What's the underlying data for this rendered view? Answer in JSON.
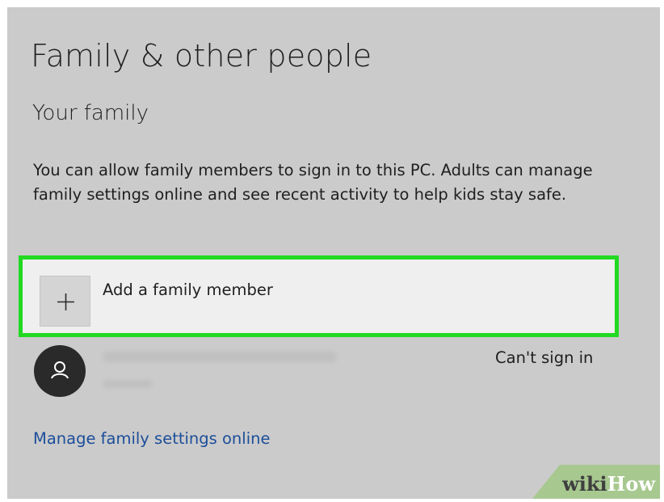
{
  "header": {
    "title": "Family & other people"
  },
  "family": {
    "section_title": "Your family",
    "description": "You can allow family members to sign in to this PC. Adults can manage family settings online and see recent activity to help kids stay safe.",
    "add_member_label": "Add a family member",
    "add_icon": "plus-icon",
    "member": {
      "avatar_icon": "person-icon",
      "status": "Can't sign in"
    },
    "manage_link": "Manage family settings online"
  },
  "watermark": {
    "part1": "wiki",
    "part2": "How"
  },
  "colors": {
    "highlight": "#21d921",
    "link": "#1c4e9a",
    "panel_bg": "#cbcbcb"
  }
}
